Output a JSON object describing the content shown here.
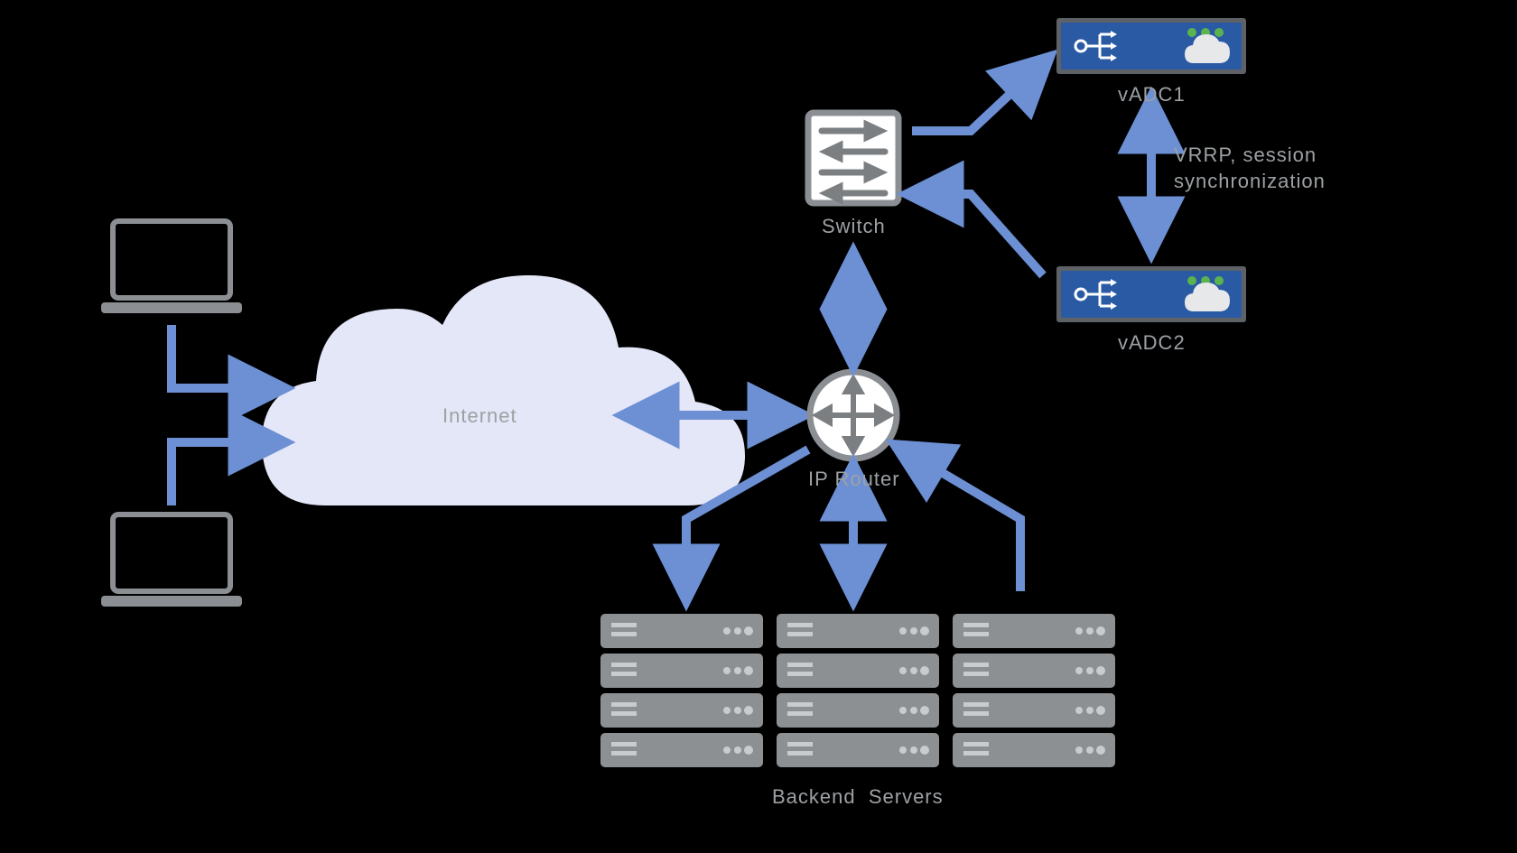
{
  "nodes": {
    "internet": {
      "label": "Internet"
    },
    "ip_router": {
      "label": "IP Router"
    },
    "switch": {
      "label": "Switch"
    },
    "vadc1": {
      "label": "vADC1"
    },
    "vadc2": {
      "label": "vADC2"
    },
    "backend_servers": {
      "label": "Backend  Servers"
    },
    "vrrp": {
      "label": "VRRP, session\nsynchronization"
    }
  },
  "colors": {
    "arrow": "#6d90d4",
    "cloud": "#e4e7f8",
    "iconStroke": "#7c7f82",
    "iconBorder": "#8b8f93",
    "server": "#8c9093",
    "adcBody": "#2a5aa4",
    "adcFrame": "#5e6266",
    "ledGreen": "#5ab44e"
  },
  "connections_description": [
    "Two client laptops connect right/down into the Internet cloud (single-headed arrows).",
    "Internet cloud ↔ IP Router (double-headed horizontal arrow).",
    "IP Router ↔ Switch (double-headed vertical arrow).",
    "Switch → vADC1 (single-headed elbow arrow up-right).",
    "Switch ← vADC2 (single-headed elbow arrow pointing back toward switch from lower right).",
    "vADC1 ↔ vADC2 vertical double-headed arrow labeled 'VRRP, session synchronization'.",
    "IP Router → three Backend Server stacks: left stack via elbow arrow, middle stack via double-headed vertical arrow, right stack via elbow arrow whose arrowhead points back toward the router."
  ]
}
